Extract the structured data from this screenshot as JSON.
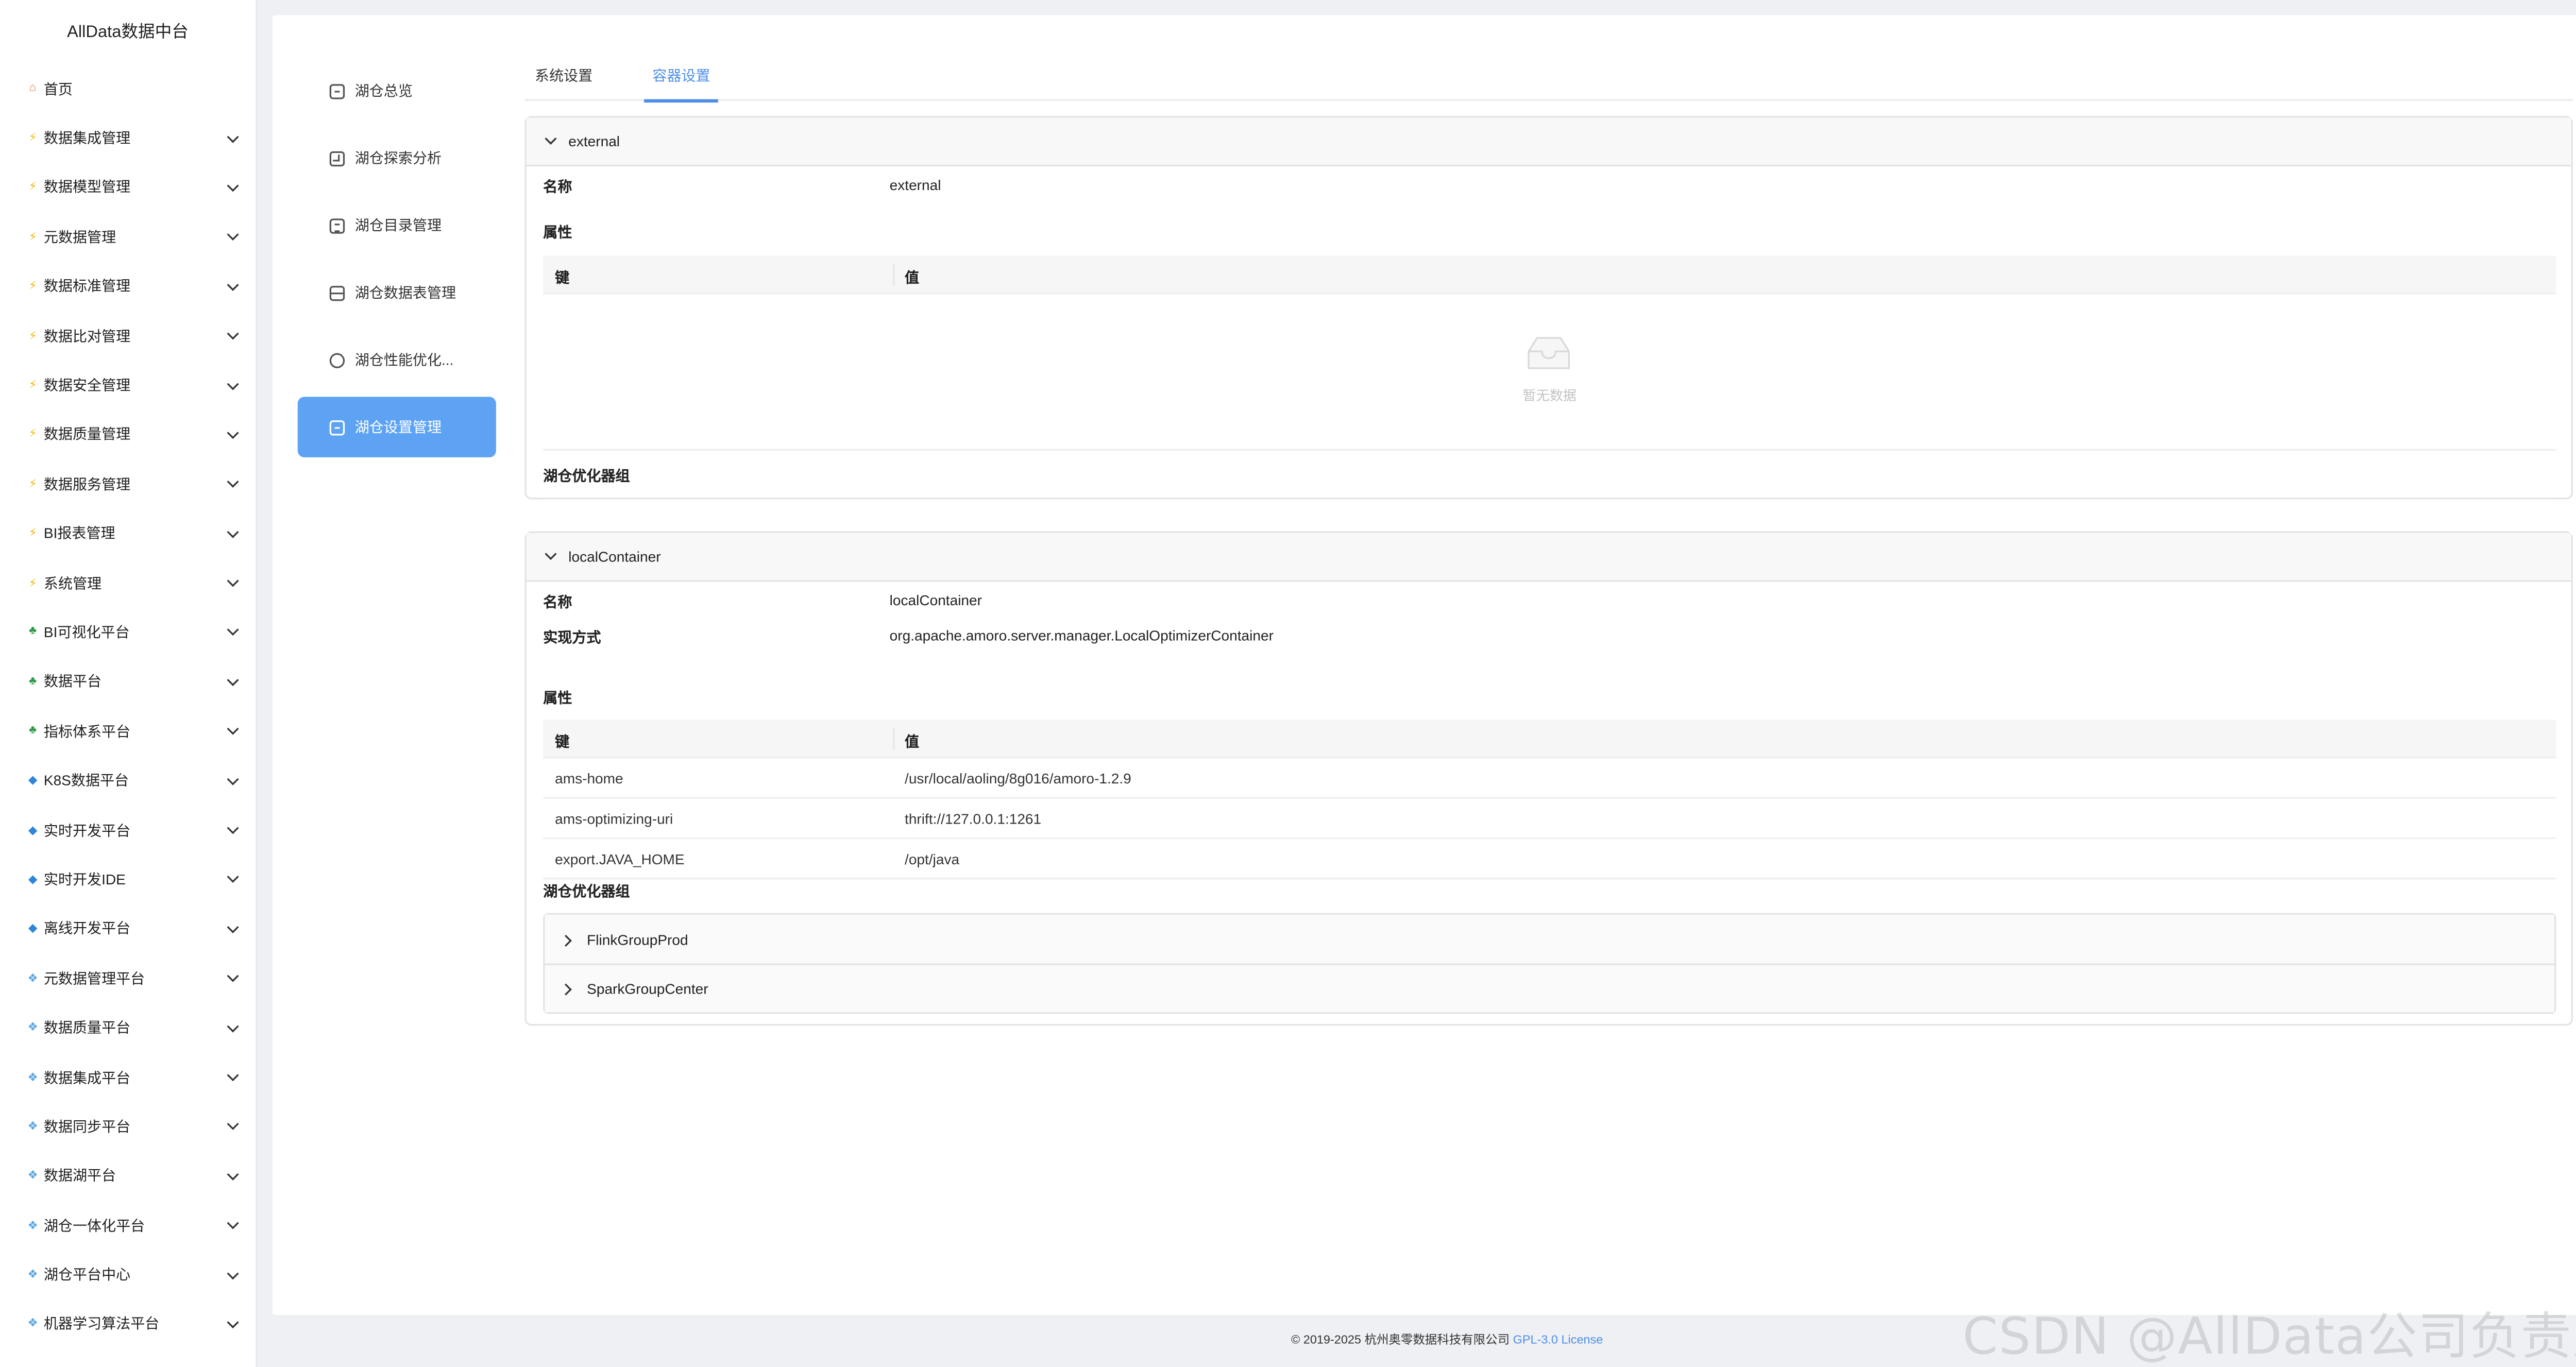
{
  "brand": "AllData数据中台",
  "sidebar": {
    "items": [
      {
        "label": "首页",
        "icon": "home",
        "has_children": false
      },
      {
        "label": "数据集成管理",
        "icon": "bolt",
        "has_children": true
      },
      {
        "label": "数据模型管理",
        "icon": "bolt",
        "has_children": true
      },
      {
        "label": "元数据管理",
        "icon": "bolt",
        "has_children": true
      },
      {
        "label": "数据标准管理",
        "icon": "bolt",
        "has_children": true
      },
      {
        "label": "数据比对管理",
        "icon": "bolt",
        "has_children": true
      },
      {
        "label": "数据安全管理",
        "icon": "bolt",
        "has_children": true
      },
      {
        "label": "数据质量管理",
        "icon": "bolt",
        "has_children": true
      },
      {
        "label": "数据服务管理",
        "icon": "bolt",
        "has_children": true
      },
      {
        "label": "BI报表管理",
        "icon": "bolt",
        "has_children": true
      },
      {
        "label": "系统管理",
        "icon": "bolt",
        "has_children": true
      },
      {
        "label": "BI可视化平台",
        "icon": "tree",
        "has_children": true
      },
      {
        "label": "数据平台",
        "icon": "tree",
        "has_children": true
      },
      {
        "label": "指标体系平台",
        "icon": "tree",
        "has_children": true
      },
      {
        "label": "K8S数据平台",
        "icon": "gem",
        "has_children": true
      },
      {
        "label": "实时开发平台",
        "icon": "gem",
        "has_children": true
      },
      {
        "label": "实时开发IDE",
        "icon": "gem",
        "has_children": true
      },
      {
        "label": "离线开发平台",
        "icon": "gem",
        "has_children": true
      },
      {
        "label": "元数据管理平台",
        "icon": "cube",
        "has_children": true
      },
      {
        "label": "数据质量平台",
        "icon": "cube",
        "has_children": true
      },
      {
        "label": "数据集成平台",
        "icon": "cube",
        "has_children": true
      },
      {
        "label": "数据同步平台",
        "icon": "cube",
        "has_children": true
      },
      {
        "label": "数据湖平台",
        "icon": "cube",
        "has_children": true
      },
      {
        "label": "湖仓一体化平台",
        "icon": "cube",
        "has_children": true
      },
      {
        "label": "湖仓平台中心",
        "icon": "cube",
        "has_children": true
      },
      {
        "label": "机器学习算法平台",
        "icon": "cube",
        "has_children": true
      }
    ]
  },
  "subnav": {
    "items": [
      {
        "label": "湖仓总览",
        "icon": "dashboard",
        "active": false
      },
      {
        "label": "湖仓探索分析",
        "icon": "explore",
        "active": false
      },
      {
        "label": "湖仓目录管理",
        "icon": "catalog",
        "active": false
      },
      {
        "label": "湖仓数据表管理",
        "icon": "table",
        "active": false
      },
      {
        "label": "湖仓性能优化...",
        "icon": "optimize",
        "active": false
      },
      {
        "label": "湖仓设置管理",
        "icon": "settings",
        "active": true
      }
    ]
  },
  "tabs": [
    {
      "label": "系统设置",
      "active": false
    },
    {
      "label": "容器设置",
      "active": true
    }
  ],
  "labels": {
    "name": "名称",
    "impl": "实现方式",
    "properties": "属性",
    "key": "键",
    "value": "值",
    "optimizer_groups": "湖仓优化器组",
    "empty": "暂无数据"
  },
  "containers": {
    "external": {
      "title": "external",
      "name": "external"
    },
    "local": {
      "title": "localContainer",
      "name": "localContainer",
      "impl": "org.apache.amoro.server.manager.LocalOptimizerContainer",
      "properties": [
        {
          "key": "ams-home",
          "value": "/usr/local/aoling/8g016/amoro-1.2.9"
        },
        {
          "key": "ams-optimizing-uri",
          "value": "thrift://127.0.0.1:1261"
        },
        {
          "key": "export.JAVA_HOME",
          "value": "/opt/java"
        }
      ],
      "groups": [
        "FlinkGroupProd",
        "SparkGroupCenter"
      ]
    }
  },
  "footer": {
    "copyright": "© 2019-2025 杭州奥零数据科技有限公司",
    "license": "GPL-3.0 License"
  },
  "watermark": "CSDN @AllData公司负责人",
  "colors": {
    "accent": "#4f8fe8",
    "active_nav": "#5ea3f3"
  }
}
